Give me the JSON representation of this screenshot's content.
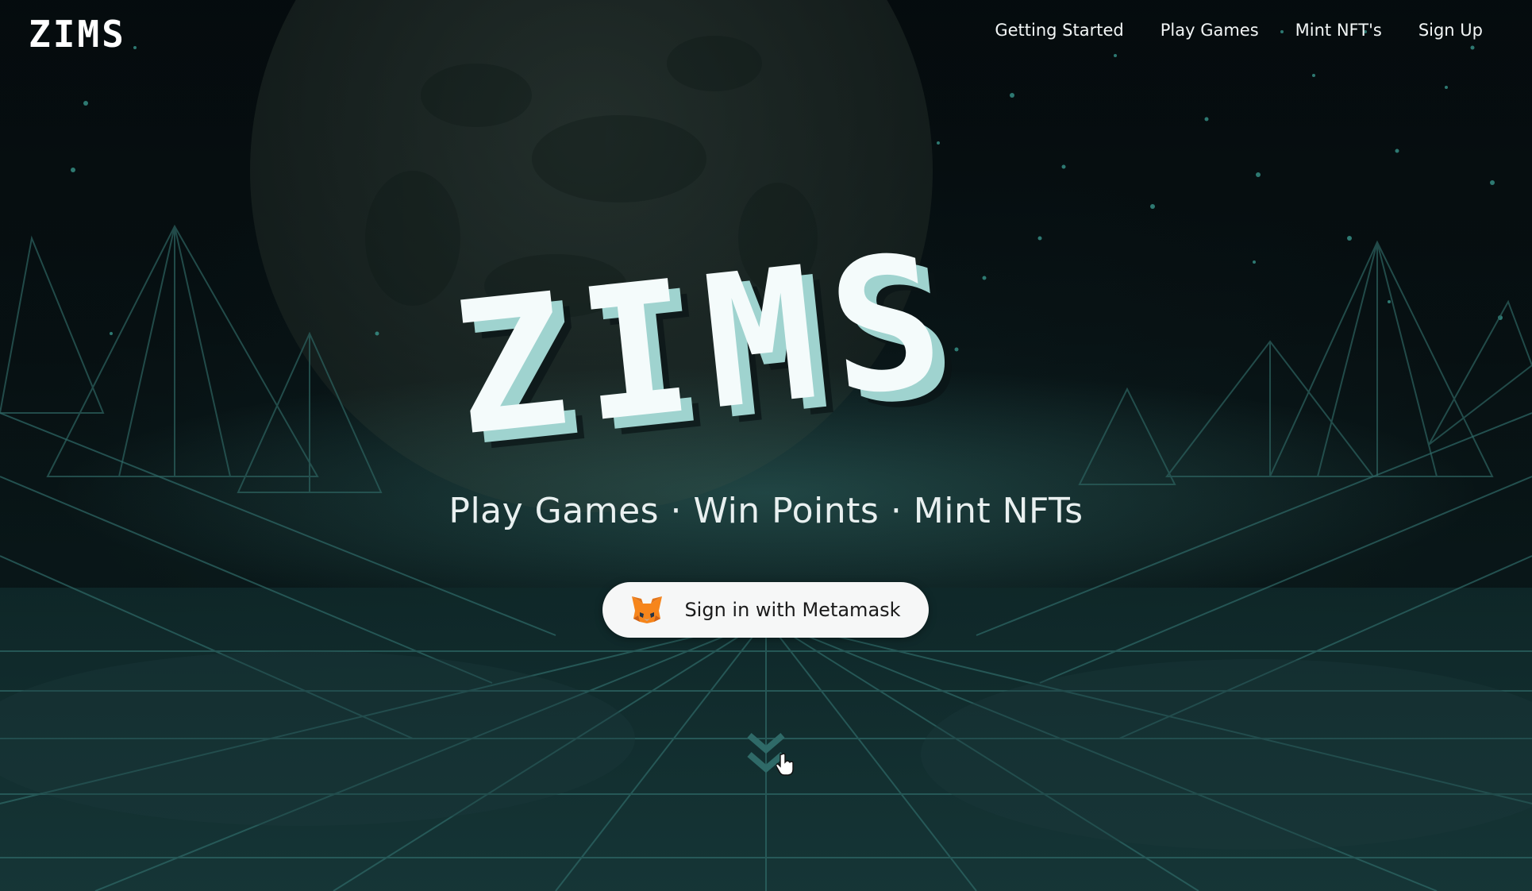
{
  "brand": {
    "logo_text": "ZIMS"
  },
  "nav": {
    "items": [
      {
        "label": "Getting Started"
      },
      {
        "label": "Play Games"
      },
      {
        "label": "Mint NFT's"
      },
      {
        "label": "Sign Up"
      }
    ]
  },
  "hero": {
    "title": "ZIMS",
    "tagline": "Play Games · Win Points · Mint NFTs",
    "cta": {
      "label": "Sign in with Metamask",
      "icon": "metamask-fox-icon"
    }
  },
  "scroll_hint": {
    "icon": "double-chevron-down-icon"
  },
  "colors": {
    "background": "#0b1b1d",
    "grid": "#2f6a68",
    "title_face": "#f4fbfb",
    "title_side": "#9fd3cf",
    "cta_bg": "#f6f7f7",
    "chevron": "#2f6a68"
  }
}
